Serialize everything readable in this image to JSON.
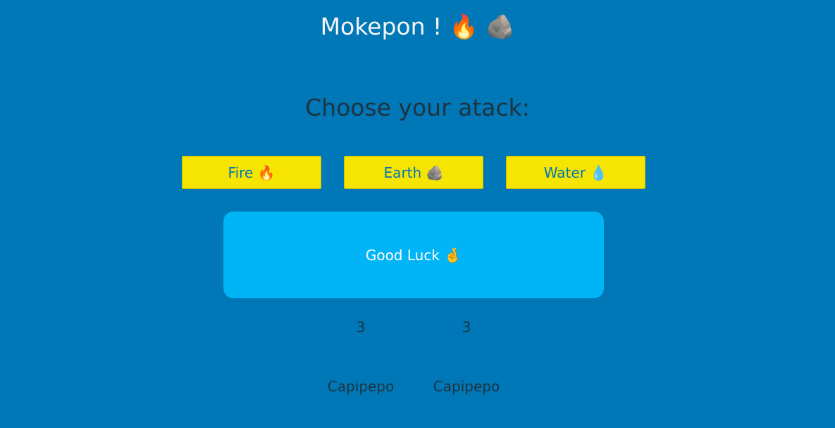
{
  "header": {
    "title": "Mokepon ! 🔥 🪨"
  },
  "attack_section": {
    "prompt": "Choose your atack:",
    "buttons": [
      {
        "label": "Fire 🔥"
      },
      {
        "label": "Earth 🪨"
      },
      {
        "label": "Water 💧"
      }
    ]
  },
  "message": {
    "text": "Good Luck 🤞"
  },
  "player": {
    "lives": "3",
    "pet_name": "Capipepo"
  },
  "enemy": {
    "lives": "3",
    "pet_name": "Capipepo"
  },
  "colors": {
    "background": "#0077b6",
    "button": "#f5e500",
    "message_box": "#00b4f5"
  }
}
